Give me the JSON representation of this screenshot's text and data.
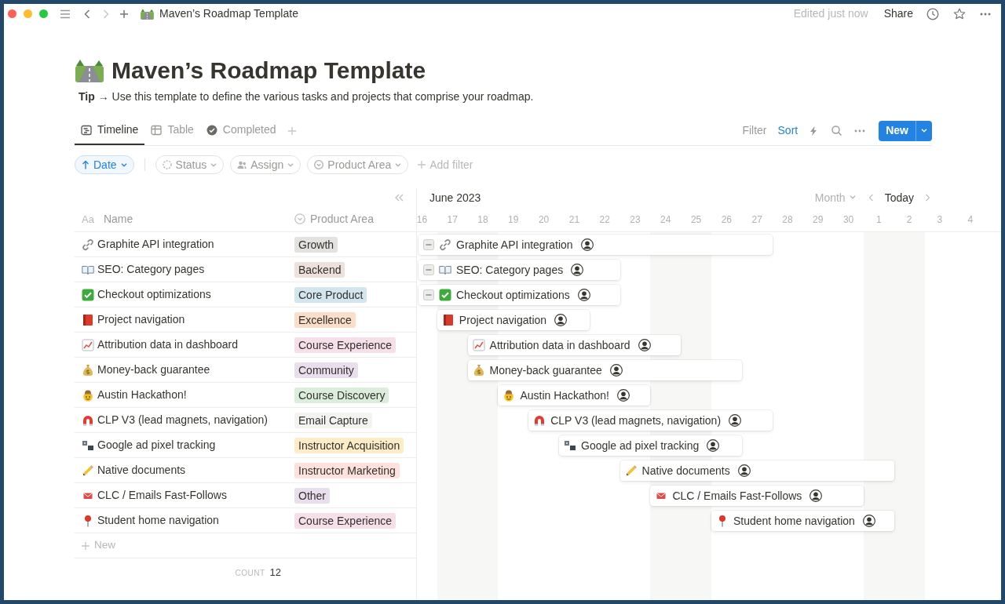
{
  "window": {
    "title": "Maven’s Roadmap Template",
    "edit_status": "Edited just now",
    "share": "Share"
  },
  "page": {
    "title": "Maven’s Roadmap Template",
    "tip": "**Tip** → Use this template to define the various tasks and projects that comprise your roadmap."
  },
  "views": [
    {
      "label": "Timeline",
      "selected": true
    },
    {
      "label": "Table",
      "selected": false
    },
    {
      "label": "Completed",
      "selected": false
    }
  ],
  "view_actions": {
    "filter": {
      "label": "Filter",
      "active": false
    },
    "sort": {
      "label": "Sort",
      "active": true
    },
    "new_button": "New"
  },
  "chips": [
    {
      "kind": "sort",
      "label": "Date"
    },
    {
      "kind": "filter",
      "label": "Status"
    },
    {
      "kind": "filter",
      "label": "Assign"
    },
    {
      "kind": "filter",
      "label": "Product Area"
    }
  ],
  "add_filter": "Add filter",
  "table": {
    "columns": [
      {
        "kind": "title",
        "type_label": "Aa",
        "label": "Name"
      },
      {
        "kind": "select",
        "label": "Product Area"
      }
    ],
    "rows": [
      {
        "name": "Graphite API integration",
        "product_area": {
          "label": "Growth",
          "color": "#e3e2e0"
        }
      },
      {
        "name": "SEO: Category pages",
        "product_area": {
          "label": "Backend",
          "color": "#eee0da"
        }
      },
      {
        "name": "Checkout optimizations",
        "product_area": {
          "label": "Core Product",
          "color": "#d3e5ef"
        }
      },
      {
        "name": "Project navigation",
        "product_area": {
          "label": "Excellence",
          "color": "#fadec9"
        }
      },
      {
        "name": "Attribution data in dashboard",
        "product_area": {
          "label": "Course Experience",
          "color": "#f5e0e9"
        }
      },
      {
        "name": "Money-back guarantee",
        "product_area": {
          "label": "Community",
          "color": "#e8deee"
        }
      },
      {
        "name": "Austin Hackathon!",
        "product_area": {
          "label": "Course Discovery",
          "color": "#dbeddb"
        }
      },
      {
        "name": "CLP V3 (lead magnets, navigation)",
        "product_area": {
          "label": "Email Capture",
          "color": "#f3f3f1"
        }
      },
      {
        "name": "Google ad pixel tracking",
        "product_area": {
          "label": "Instructor Acquisition",
          "color": "#fdecc8"
        }
      },
      {
        "name": "Native documents",
        "product_area": {
          "label": "Instructor Marketing",
          "color": "#ffe2dd"
        }
      },
      {
        "name": "CLC / Emails Fast-Follows",
        "product_area": {
          "label": "Other",
          "color": "#e8deee"
        }
      },
      {
        "name": "Student home navigation",
        "product_area": {
          "label": "Course Experience",
          "color": "#f5e0e9"
        }
      }
    ],
    "new_row": "New",
    "count": {
      "label": "COUNT",
      "value": "12"
    }
  },
  "timeline": {
    "month": "June 2023",
    "scale": "Month",
    "today": "Today",
    "days": [
      {
        "label": "16",
        "weekend": false
      },
      {
        "label": "17",
        "weekend": true
      },
      {
        "label": "18",
        "weekend": true
      },
      {
        "label": "19",
        "weekend": false
      },
      {
        "label": "20",
        "weekend": false
      },
      {
        "label": "21",
        "weekend": false
      },
      {
        "label": "22",
        "weekend": false
      },
      {
        "label": "23",
        "weekend": false
      },
      {
        "label": "24",
        "weekend": true
      },
      {
        "label": "25",
        "weekend": true
      },
      {
        "label": "26",
        "weekend": false
      },
      {
        "label": "27",
        "weekend": false
      },
      {
        "label": "28",
        "weekend": false
      },
      {
        "label": "29",
        "weekend": false
      },
      {
        "label": "30",
        "weekend": false
      },
      {
        "label": "1",
        "weekend": true
      },
      {
        "label": "2",
        "weekend": true
      },
      {
        "label": "3",
        "weekend": false
      },
      {
        "label": "4",
        "weekend": false
      }
    ],
    "items": [
      {
        "name": "Graphite API integration"
      },
      {
        "name": "SEO: Category pages"
      },
      {
        "name": "Checkout optimizations"
      },
      {
        "name": "Project navigation"
      },
      {
        "name": "Attribution data in dashboard"
      },
      {
        "name": "Money-back guarantee"
      },
      {
        "name": "Austin Hackathon!"
      },
      {
        "name": "CLP V3 (lead magnets, navigation)"
      },
      {
        "name": "Google ad pixel tracking"
      },
      {
        "name": "Native documents"
      },
      {
        "name": "CLC / Emails Fast-Follows"
      },
      {
        "name": "Student home navigation"
      }
    ]
  }
}
